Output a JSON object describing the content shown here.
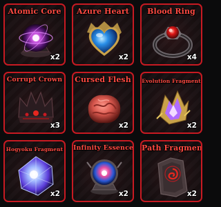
{
  "inventory": {
    "items": [
      {
        "name": "Atomic Core",
        "quantity": "x2",
        "icon": "atomic-core-icon"
      },
      {
        "name": "Azure Heart",
        "quantity": "x2",
        "icon": "azure-heart-icon"
      },
      {
        "name": "Blood Ring",
        "quantity": "x4",
        "icon": "blood-ring-icon"
      },
      {
        "name": "Corrupt Crown",
        "quantity": "x3",
        "icon": "corrupt-crown-icon"
      },
      {
        "name": "Cursed Flesh",
        "quantity": "x2",
        "icon": "cursed-flesh-icon"
      },
      {
        "name": "Evolution Fragment",
        "quantity": "x2",
        "icon": "evolution-fragment-icon"
      },
      {
        "name": "Hogyoku Fragment",
        "quantity": "x2",
        "icon": "hogyoku-fragment-icon"
      },
      {
        "name": "Infinity Essence",
        "quantity": "x2",
        "icon": "infinity-essence-icon"
      },
      {
        "name": "Path Fragment",
        "quantity": "x2",
        "icon": "path-fragment-icon"
      }
    ]
  },
  "colors": {
    "border": "#c81a22",
    "title": "#ff4a42",
    "background": "#0b0b0c"
  }
}
